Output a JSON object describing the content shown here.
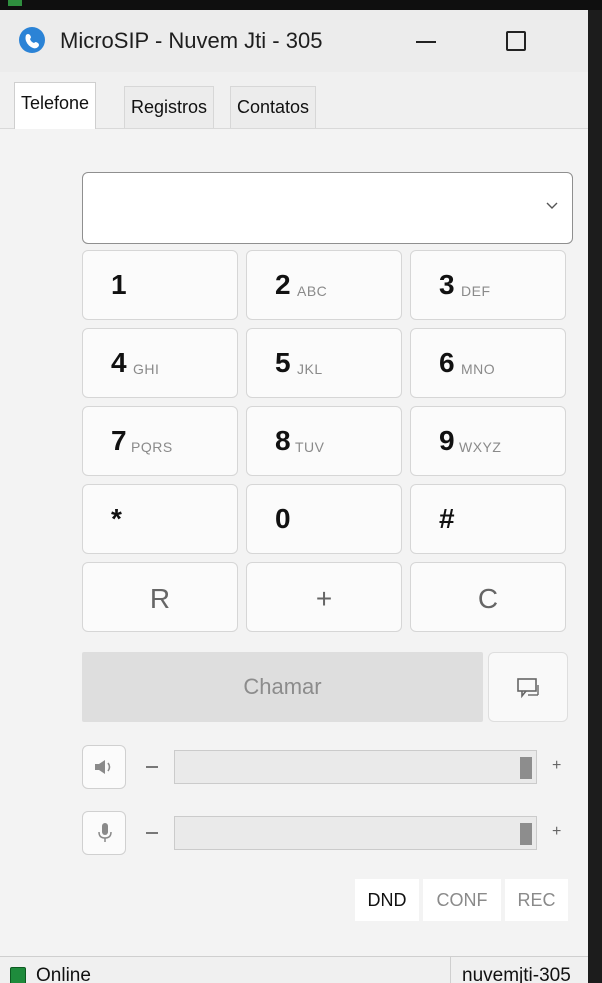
{
  "window": {
    "title": "MicroSIP - Nuvem Jti - 305"
  },
  "tabs": [
    {
      "label": "Telefone"
    },
    {
      "label": "Registros"
    },
    {
      "label": "Contatos"
    }
  ],
  "dialpad": {
    "keys": [
      {
        "digit": "1",
        "letters": ""
      },
      {
        "digit": "2",
        "letters": "ABC"
      },
      {
        "digit": "3",
        "letters": "DEF"
      },
      {
        "digit": "4",
        "letters": "GHI"
      },
      {
        "digit": "5",
        "letters": "JKL"
      },
      {
        "digit": "6",
        "letters": "MNO"
      },
      {
        "digit": "7",
        "letters": "PQRS"
      },
      {
        "digit": "8",
        "letters": "TUV"
      },
      {
        "digit": "9",
        "letters": "WXYZ"
      },
      {
        "digit": "*",
        "letters": ""
      },
      {
        "digit": "0",
        "letters": ""
      },
      {
        "digit": "#",
        "letters": ""
      }
    ],
    "func_keys": {
      "redial": "R",
      "plus": "+",
      "clear": "C"
    }
  },
  "call": {
    "label": "Chamar"
  },
  "audio": {
    "speaker_minus": "–",
    "speaker_plus": "+",
    "mic_minus": "–",
    "mic_plus": "+",
    "speaker_level": 1.0,
    "mic_level": 1.0
  },
  "flags": {
    "dnd": "DND",
    "conf": "CONF",
    "rec": "REC"
  },
  "status": {
    "text": "Online",
    "account": "nuvemjti-305"
  }
}
